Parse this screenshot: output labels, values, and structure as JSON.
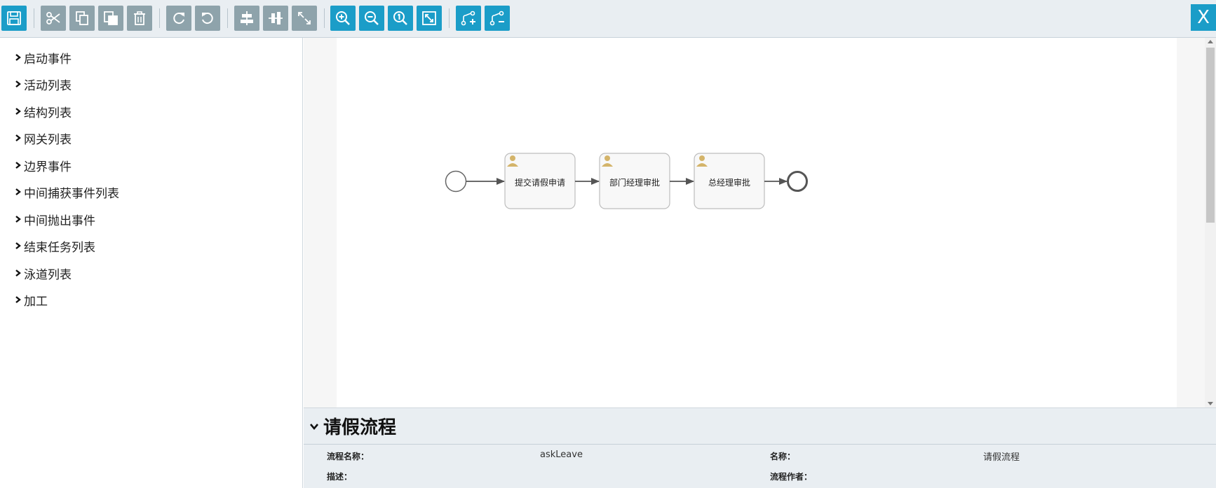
{
  "toolbar": {
    "buttons": [
      {
        "icon": "save-icon",
        "style": "blue"
      },
      {
        "icon": "cut-icon",
        "style": "gray"
      },
      {
        "icon": "copy-icon",
        "style": "gray"
      },
      {
        "icon": "paste-icon",
        "style": "gray"
      },
      {
        "icon": "delete-icon",
        "style": "gray"
      },
      {
        "icon": "redo-icon",
        "style": "gray"
      },
      {
        "icon": "undo-icon",
        "style": "gray"
      },
      {
        "icon": "align-horizontal-icon",
        "style": "gray"
      },
      {
        "icon": "align-vertical-icon",
        "style": "gray"
      },
      {
        "icon": "same-size-icon",
        "style": "gray"
      },
      {
        "icon": "zoom-in-icon",
        "style": "blue"
      },
      {
        "icon": "zoom-out-icon",
        "style": "blue"
      },
      {
        "icon": "zoom-actual-icon",
        "style": "blue"
      },
      {
        "icon": "zoom-fit-icon",
        "style": "blue"
      },
      {
        "icon": "add-bendpoint-icon",
        "style": "blue"
      },
      {
        "icon": "remove-bendpoint-icon",
        "style": "blue"
      }
    ],
    "close_label": "X"
  },
  "palette": {
    "items": [
      {
        "label": "启动事件"
      },
      {
        "label": "活动列表"
      },
      {
        "label": "结构列表"
      },
      {
        "label": "网关列表"
      },
      {
        "label": "边界事件"
      },
      {
        "label": "中间捕获事件列表"
      },
      {
        "label": "中间抛出事件"
      },
      {
        "label": "结束任务列表"
      },
      {
        "label": "泳道列表"
      },
      {
        "label": "加工"
      }
    ]
  },
  "diagram": {
    "tasks": [
      {
        "label": "提交请假申请"
      },
      {
        "label": "部门经理审批"
      },
      {
        "label": "总经理审批"
      }
    ]
  },
  "properties": {
    "title": "请假流程",
    "process_name_label": "流程名称：",
    "process_name_value": "askLeave",
    "name_label": "名称：",
    "name_value": "请假流程",
    "description_label": "描述：",
    "author_label": "流程作者："
  },
  "colors": {
    "accent_blue": "#1b9dc8",
    "button_gray": "#8ea3ab",
    "toolbar_bg": "#e9eef2",
    "task_fill": "#f8f8f8",
    "user_icon": "#d4b46a"
  }
}
